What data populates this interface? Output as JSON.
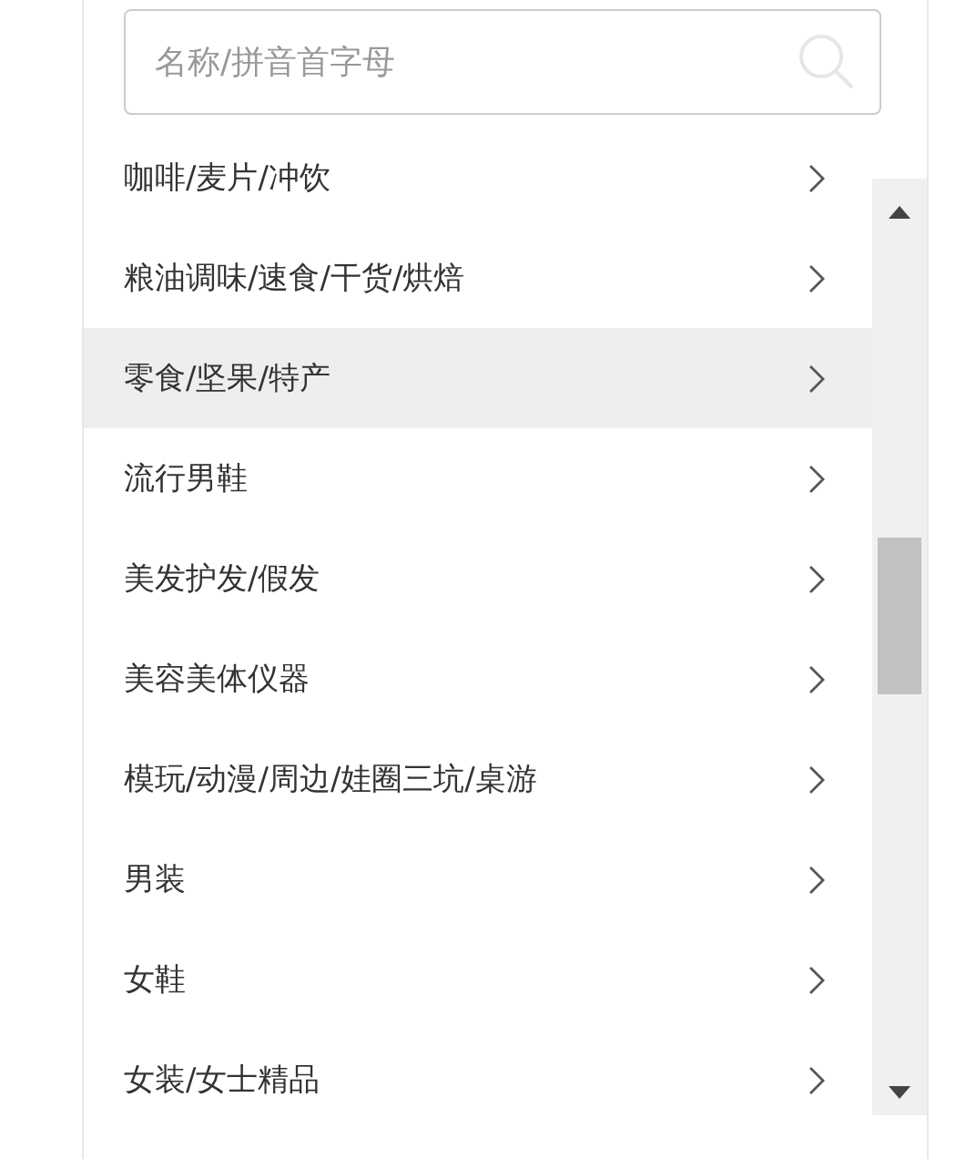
{
  "search": {
    "placeholder": "名称/拼音首字母"
  },
  "categories": [
    {
      "label": "咖啡/麦片/冲饮",
      "highlighted": false
    },
    {
      "label": "粮油调味/速食/干货/烘焙",
      "highlighted": false
    },
    {
      "label": "零食/坚果/特产",
      "highlighted": true
    },
    {
      "label": "流行男鞋",
      "highlighted": false
    },
    {
      "label": "美发护发/假发",
      "highlighted": false
    },
    {
      "label": "美容美体仪器",
      "highlighted": false
    },
    {
      "label": "模玩/动漫/周边/娃圈三坑/桌游",
      "highlighted": false
    },
    {
      "label": "男装",
      "highlighted": false
    },
    {
      "label": "女鞋",
      "highlighted": false
    },
    {
      "label": "女装/女士精品",
      "highlighted": false
    }
  ]
}
